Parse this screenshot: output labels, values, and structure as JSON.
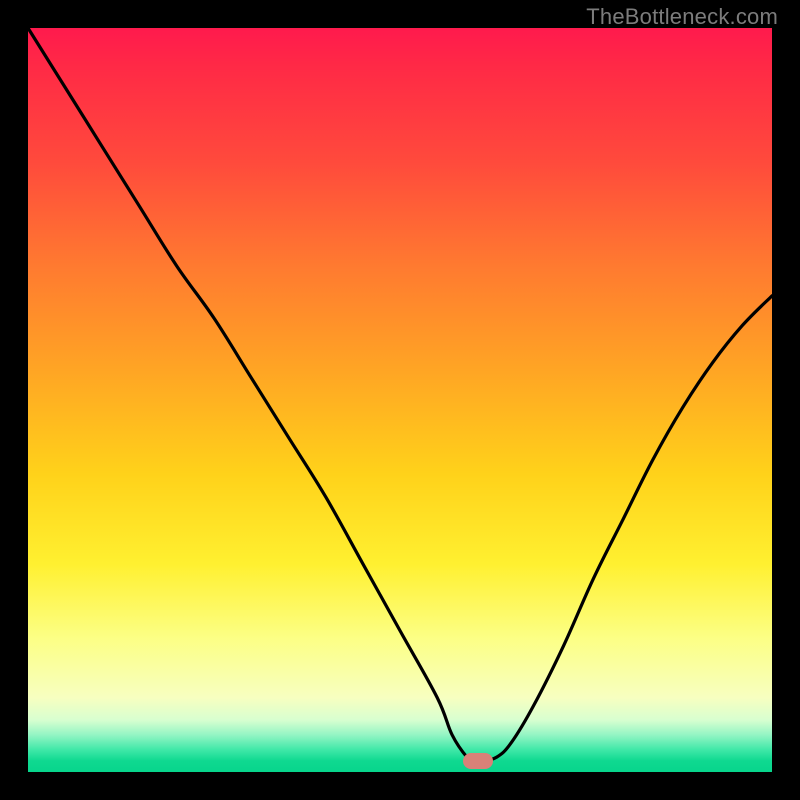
{
  "watermark": "TheBottleneck.com",
  "colors": {
    "background": "#000000",
    "curve": "#000000",
    "marker": "#d88178"
  },
  "chart_data": {
    "type": "line",
    "title": "",
    "xlabel": "",
    "ylabel": "",
    "xlim": [
      0,
      100
    ],
    "ylim": [
      0,
      100
    ],
    "grid": false,
    "annotations": {
      "marker": {
        "x": 60.5,
        "y": 1.5,
        "shape": "rounded-rect"
      }
    },
    "series": [
      {
        "name": "curve",
        "x": [
          0,
          5,
          10,
          15,
          20,
          25,
          30,
          35,
          40,
          45,
          50,
          55,
          57,
          59,
          60,
          61,
          63,
          65,
          68,
          72,
          76,
          80,
          84,
          88,
          92,
          96,
          100
        ],
        "y": [
          100,
          92,
          84,
          76,
          68,
          61,
          53,
          45,
          37,
          28,
          19,
          10,
          5,
          2,
          1.5,
          1.5,
          2,
          4,
          9,
          17,
          26,
          34,
          42,
          49,
          55,
          60,
          64
        ]
      }
    ]
  }
}
